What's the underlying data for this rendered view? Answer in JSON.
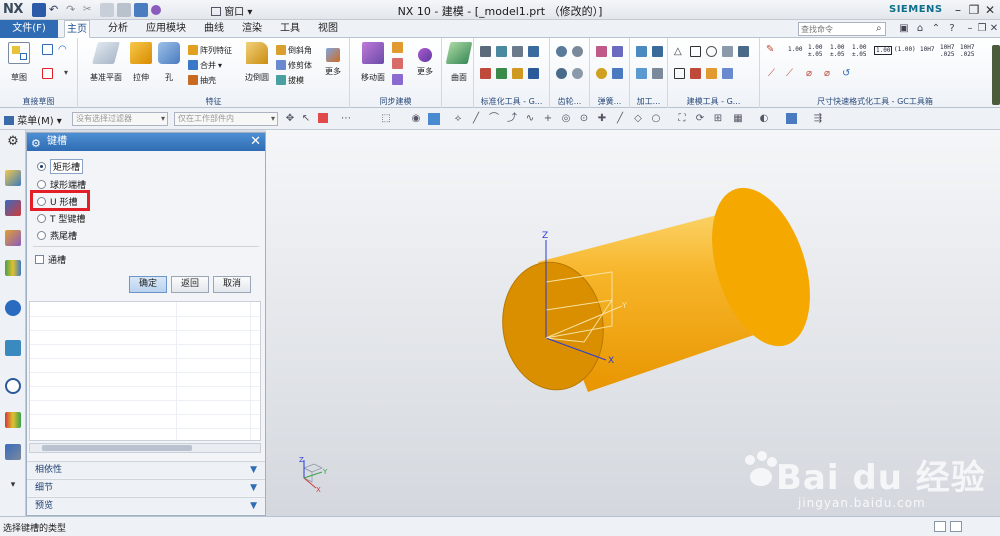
{
  "titlebar": {
    "logo": "NX",
    "window_menu": "窗口",
    "title": "NX 10 - 建模 - [_model1.prt （修改的）]",
    "brand": "SIEMENS"
  },
  "tabs": {
    "file": "文件(F)",
    "items": [
      "主页",
      "分析",
      "应用模块",
      "曲线",
      "渲染",
      "工具",
      "视图"
    ],
    "active_index": 0,
    "search_placeholder": "查找命令"
  },
  "ribbon": {
    "sketch": "草图",
    "datum_plane": "基准平面",
    "extrude": "拉伸",
    "hole": "孔",
    "pattern_feature": "阵列特征",
    "unite": "合并",
    "shell": "抽壳",
    "edge_blend": "边倒圆",
    "chamfer": "倒斜角",
    "trim_body": "修剪体",
    "draft": "拔模",
    "more1": "更多",
    "move_face": "移动面",
    "more2": "更多",
    "surface": "曲面",
    "groups": {
      "direct_sketch": "直接草图",
      "feature": "特征",
      "sync_modeling": "同步建模",
      "standard_tools": "标准化工具 - G...",
      "gear": "齿轮...",
      "spring": "弹簧...",
      "machining": "加工...",
      "modeling_tools": "建模工具 - G...",
      "dimension": "尺寸快速格式化工具 - GC工具箱"
    }
  },
  "selbar": {
    "menu": "菜单(M)",
    "filter_placeholder": "没有选择过滤器",
    "scope": "仅在工作部件内"
  },
  "dialog": {
    "title": "键槽",
    "options": [
      "矩形槽",
      "球形端槽",
      "U 形槽",
      "T 型键槽",
      "燕尾槽"
    ],
    "selected_index": 0,
    "through_label": "通槽",
    "ok": "确定",
    "back": "返回",
    "cancel": "取消",
    "sections": [
      "相依性",
      "细节",
      "预览"
    ]
  },
  "viewport": {
    "axis_z": "Z",
    "axis_x": "X",
    "axis_y": "Y",
    "body_color": "#f2a200",
    "face_color": "#d98a00"
  },
  "watermark": {
    "brand": "Bai du 经验",
    "url": "jingyan.baidu.com"
  },
  "status": {
    "text": "选择键槽的类型"
  },
  "colors": {
    "accent": "#2f6cb3",
    "highlight": "#e41e26"
  }
}
